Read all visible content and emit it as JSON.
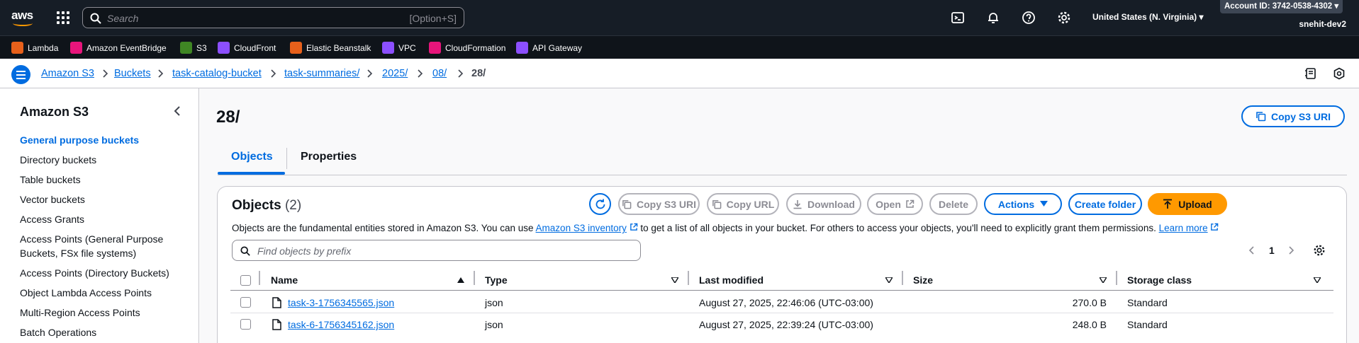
{
  "topbar": {
    "logo_text": "aws",
    "search_placeholder": "Search",
    "search_shortcut": "[Option+S]",
    "region": "United States (N. Virginia)",
    "account": "Account ID: 3742-0538-4302",
    "user": "snehit-dev2"
  },
  "favorites": [
    {
      "label": "Lambda",
      "color": "#e7601b"
    },
    {
      "label": "Amazon EventBridge",
      "color": "#e7157b"
    },
    {
      "label": "S3",
      "color": "#3f8624"
    },
    {
      "label": "CloudFront",
      "color": "#8c4fff"
    },
    {
      "label": "Elastic Beanstalk",
      "color": "#e7601b"
    },
    {
      "label": "VPC",
      "color": "#8c4fff"
    },
    {
      "label": "CloudFormation",
      "color": "#e7157b"
    },
    {
      "label": "API Gateway",
      "color": "#8c4fff"
    }
  ],
  "breadcrumbs": [
    "Amazon S3",
    "Buckets",
    "task-catalog-bucket",
    "task-summaries/",
    "2025/",
    "08/",
    "28/"
  ],
  "sidebar": {
    "title": "Amazon S3",
    "items": [
      "General purpose buckets",
      "Directory buckets",
      "Table buckets",
      "Vector buckets",
      "Access Grants",
      "Access Points (General Purpose",
      "Buckets, FSx file systems)",
      "Access Points (Directory Buckets)",
      "Object Lambda Access Points",
      "Multi-Region Access Points",
      "Batch Operations"
    ]
  },
  "main": {
    "title": "28/",
    "copy_uri_label": "Copy S3 URI",
    "tabs": [
      "Objects",
      "Properties"
    ]
  },
  "panel": {
    "title": "Objects",
    "count": "(2)",
    "buttons": {
      "copy_s3_uri": "Copy S3 URI",
      "copy_url": "Copy URL",
      "download": "Download",
      "open": "Open",
      "delete": "Delete",
      "actions": "Actions",
      "create_folder": "Create folder",
      "upload": "Upload"
    },
    "desc_pre": "Objects are the fundamental entities stored in Amazon S3. You can use",
    "desc_link": "Amazon S3 inventory",
    "desc_post": "to get a list of all objects in your bucket. For others to access your objects, you'll need to explicitly grant them permissions.",
    "learn_more": "Learn more",
    "filter_placeholder": "Find objects by prefix",
    "page": "1",
    "columns": [
      "Name",
      "Type",
      "Last modified",
      "Size",
      "Storage class"
    ],
    "rows": [
      {
        "name": "task-3-1756345565.json",
        "type": "json",
        "modified": "August 27, 2025, 22:46:06 (UTC-03:00)",
        "size": "270.0 B",
        "storage": "Standard"
      },
      {
        "name": "task-6-1756345162.json",
        "type": "json",
        "modified": "August 27, 2025, 22:39:24 (UTC-03:00)",
        "size": "248.0 B",
        "storage": "Standard"
      }
    ]
  }
}
